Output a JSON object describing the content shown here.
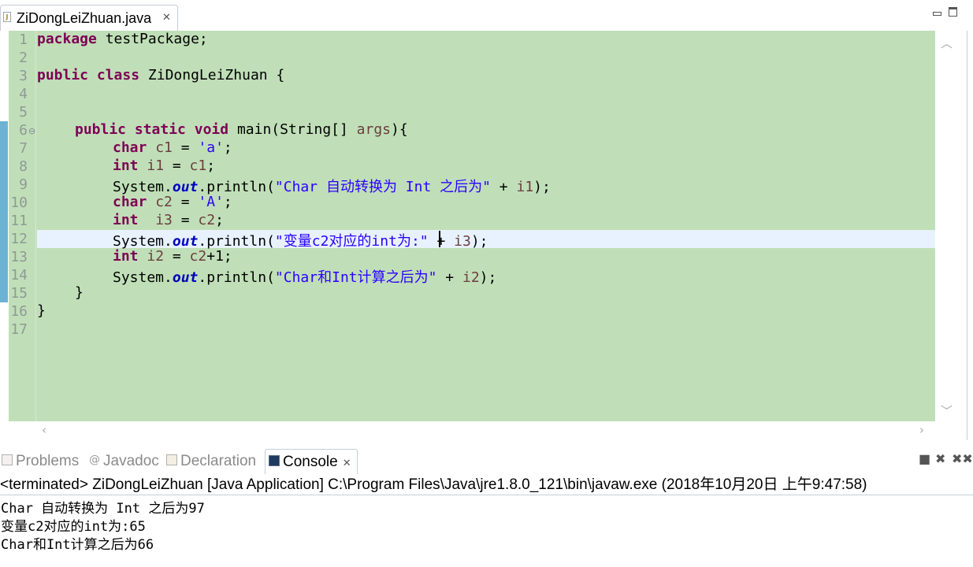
{
  "editor_tab": {
    "title": "ZiDongLeiZhuan.java",
    "close_glyph": "✕"
  },
  "window_buttons": {
    "minimize": "minimize",
    "maximize": "maximize"
  },
  "line_numbers": [
    "1",
    "2",
    "3",
    "4",
    "5",
    "6",
    "7",
    "8",
    "9",
    "10",
    "11",
    "12",
    "13",
    "14",
    "15",
    "16",
    "17"
  ],
  "code": {
    "l1_kw": "package",
    "l1_rest": " testPackage;",
    "l3_kw1": "public",
    "l3_kw2": "class",
    "l3_rest": " ZiDongLeiZhuan {",
    "l6_kw1": "public",
    "l6_kw2": "static",
    "l6_kw3": "void",
    "l6_mid": " main(String[] ",
    "l6_param": "args",
    "l6_end": "){",
    "l7_kw": "char",
    "l7_var": " c1",
    "l7_mid": " = ",
    "l7_str": "'a'",
    "l7_end": ";",
    "l8_kw": "int",
    "l8_var": " i1",
    "l8_mid": " = ",
    "l8_var2": "c1",
    "l8_end": ";",
    "l9_a": "System.",
    "l9_out": "out",
    "l9_b": ".println(",
    "l9_str": "\"Char 自动转换为 Int 之后为\"",
    "l9_c": " + ",
    "l9_var": "i1",
    "l9_end": ");",
    "l10_kw": "char",
    "l10_var": " c2",
    "l10_mid": " = ",
    "l10_str": "'A'",
    "l10_end": ";",
    "l11_kw": "int",
    "l11_var": "  i3",
    "l11_mid": " = ",
    "l11_var2": "c2",
    "l11_end": ";",
    "l12_a": "System.",
    "l12_out": "out",
    "l12_b": ".println(",
    "l12_str": "\"变量c2对应的int为:\"",
    "l12_c": " + ",
    "l12_var": "i3",
    "l12_end": ");",
    "l13_kw": "int",
    "l13_var": " i2",
    "l13_mid": " = ",
    "l13_var2": "c2",
    "l13_end": "+1;",
    "l14_a": "System.",
    "l14_out": "out",
    "l14_b": ".println(",
    "l14_str": "\"Char和Int计算之后为\"",
    "l14_c": " + ",
    "l14_var": "i2",
    "l14_end": ");",
    "l15": "}",
    "l16": "}"
  },
  "panel_tabs": {
    "problems": "Problems",
    "javadoc": "Javadoc",
    "declaration": "Declaration",
    "console": "Console",
    "console_close": "✕"
  },
  "panel_tools": {
    "stop_icon": "■",
    "remove_icon": "✖",
    "remove_all_icon": "✖✖"
  },
  "console": {
    "header": "<terminated> ZiDongLeiZhuan [Java Application] C:\\Program Files\\Java\\jre1.8.0_121\\bin\\javaw.exe (2018年10月20日 上午9:47:58)",
    "lines": [
      "Char 自动转换为 Int 之后为97",
      "变量c2对应的int为:65",
      "Char和Int计算之后为66"
    ]
  },
  "colors": {
    "editor_bg": "#c0dfb8",
    "current_line": "#e8f2fe",
    "keyword": "#7f0055",
    "string": "#2a00ff",
    "static_field": "#0000c0",
    "variable": "#6a3e3e"
  }
}
